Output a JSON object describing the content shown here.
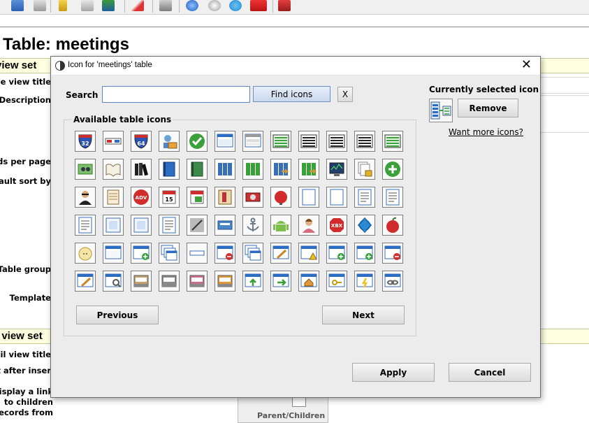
{
  "background": {
    "page_title": "Table: meetings",
    "section1": "view set",
    "section2": "l view set",
    "labels": {
      "table_view_title": "able view title",
      "description": "Description",
      "records_per_page": "ords per page",
      "default_sort": "efault sort by",
      "table_group": "Table group",
      "template": "Template",
      "detail_view_title": "etail view title",
      "after_insert": "ct after inser",
      "display_link": "Display a link",
      "to_children": "to children",
      "records_from": "records from"
    },
    "parent_children": "Parent/Children"
  },
  "dialog": {
    "title": "Icon for 'meetings' table",
    "close_glyph": "✕",
    "search_label": "Search",
    "search_value": "",
    "find_label": "Find icons",
    "clear_label": "X",
    "available_label": "Available table icons",
    "current_label": "Currently selected icon",
    "remove_label": "Remove",
    "more_icons_label": "Want more icons?",
    "prev_label": "Previous",
    "next_label": "Next",
    "apply_label": "Apply",
    "cancel_label": "Cancel"
  },
  "icons": [
    [
      "interstate-32-icon",
      "3d-glasses-icon",
      "interstate-64-icon",
      "user-credit-card-icon",
      "check-mark-icon",
      "window-icon",
      "window-split-icon",
      "table-green-icon",
      "table-black-icon",
      "table-dark-icon",
      "table-grid-black-icon",
      "table-grid-green-icon"
    ],
    [
      "money-people-icon",
      "open-book-icon",
      "books-black-icon",
      "book-blue-icon",
      "book-green-icon",
      "binders-blue-icon",
      "binders-green-icon",
      "binder-arrow-icon",
      "binder-green-arrow-icon",
      "monitor-graph-icon",
      "documents-lock-icon",
      "add-green-icon"
    ],
    [
      "agent-icon",
      "notepad-icon",
      "adv-badge-icon",
      "calendar-15-icon",
      "calendar-edit-icon",
      "shelf-book-icon",
      "graphics-card-icon",
      "alarm-bell-icon",
      "blank-page-icon",
      "blank-page-2-icon",
      "text-page-icon",
      "text-page-2-icon"
    ],
    [
      "text-page-3-icon",
      "framed-page-icon",
      "framed-page-2-icon",
      "text-page-4-icon",
      "pen-diagonal-icon",
      "card-reader-icon",
      "anchor-icon",
      "android-icon",
      "support-lady-icon",
      "xbox-stop-icon",
      "network-blue-icon",
      "red-apple-icon"
    ],
    [
      "apple-half-icon",
      "window-blue-icon",
      "window-add-icon",
      "windows-cascade-icon",
      "window-minimize-icon",
      "window-delete-icon",
      "windows-stack-icon",
      "window-edit-icon",
      "window-warning-icon",
      "window-list-add-icon",
      "window-list-add-2-icon",
      "window-list-delete-icon"
    ],
    [
      "window-pencil-icon",
      "window-search-icon",
      "inbox-tray-icon",
      "inbox-tray-gray-icon",
      "inbox-tray-pink-icon",
      "inbox-tray-orange-icon",
      "window-up-arrow-icon",
      "window-right-arrow-icon",
      "window-home-icon",
      "window-key-icon",
      "window-lightning-icon",
      "window-link-icon"
    ]
  ],
  "colors": {
    "accent_blue": "#2b6cc4",
    "green": "#3aa03a",
    "red": "#d22b2b",
    "section_band": "#ffffe0",
    "dialog_bg": "#ececec"
  }
}
